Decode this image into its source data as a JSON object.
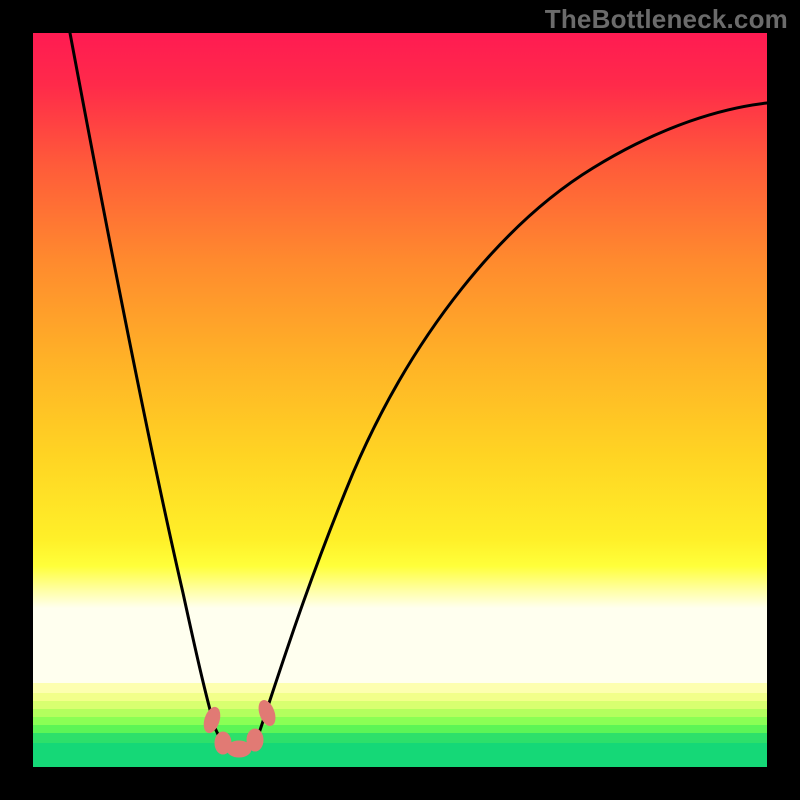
{
  "watermark": "TheBottleneck.com",
  "chart_data": {
    "type": "line",
    "title": "",
    "xlabel": "",
    "ylabel": "",
    "xlim": [
      0,
      100
    ],
    "ylim": [
      0,
      100
    ],
    "grid": false,
    "legend": false,
    "background": {
      "kind": "vertical-heat-gradient",
      "stops": [
        {
          "pos": 0.0,
          "color": "#ff1b52"
        },
        {
          "pos": 0.2,
          "color": "#ff5a3a"
        },
        {
          "pos": 0.5,
          "color": "#ffb127"
        },
        {
          "pos": 0.78,
          "color": "#fff029"
        },
        {
          "pos": 0.88,
          "color": "#ffffef"
        },
        {
          "pos": 0.95,
          "color": "#5cf556"
        },
        {
          "pos": 1.0,
          "color": "#15d877"
        }
      ]
    },
    "series": [
      {
        "name": "bottleneck-curve",
        "x": [
          5,
          10,
          15,
          20,
          24,
          26,
          28,
          30,
          35,
          45,
          60,
          75,
          90,
          100
        ],
        "y": [
          100,
          70,
          45,
          23,
          8,
          3,
          2,
          3,
          10,
          30,
          55,
          75,
          86,
          90
        ]
      }
    ],
    "markers": [
      {
        "name": "optimal-region",
        "color": "#e17a74",
        "x_range": [
          24,
          32
        ],
        "y_near": 3
      }
    ]
  }
}
